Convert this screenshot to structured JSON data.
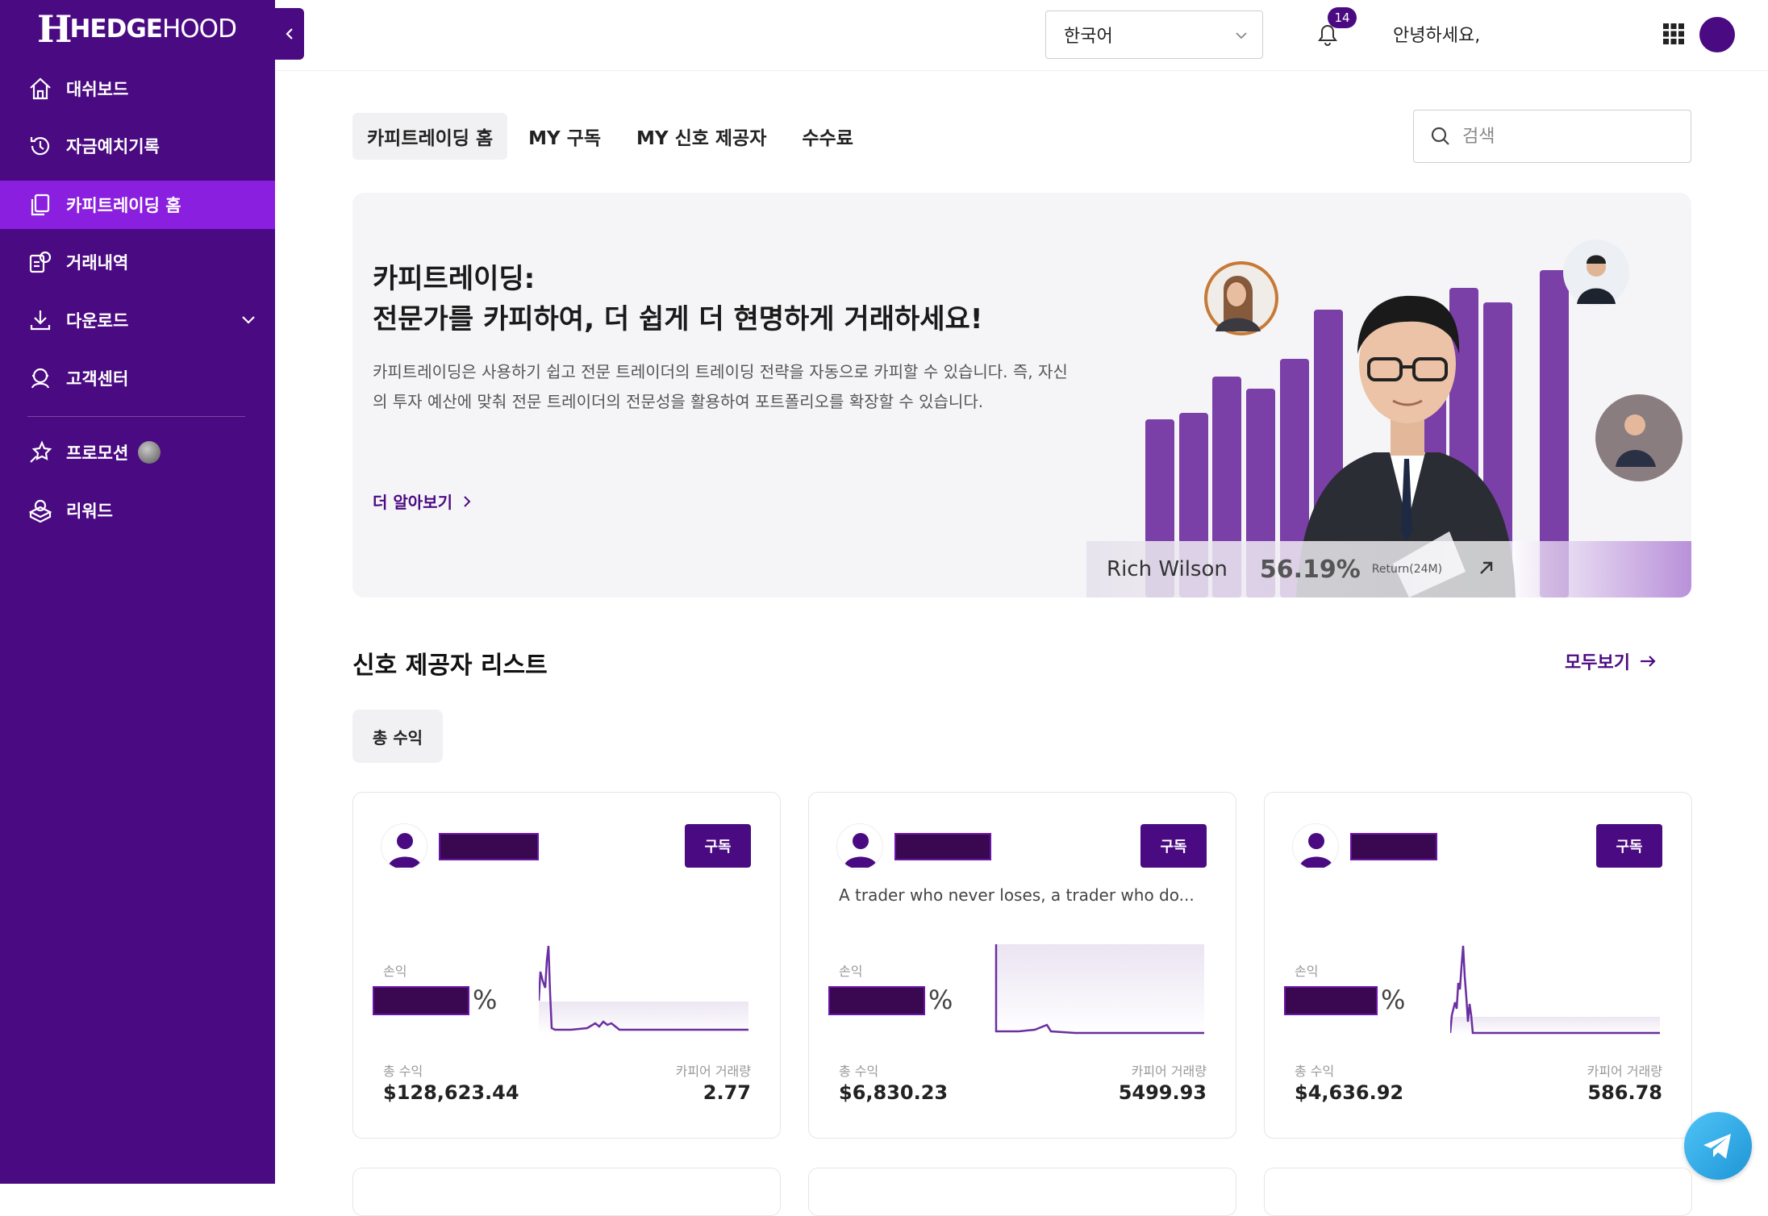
{
  "brand": {
    "name_bold": "HEDGE",
    "name_light": "HOOD"
  },
  "sidebar": {
    "items": [
      {
        "label": "대쉬보드",
        "icon": "home-icon"
      },
      {
        "label": "자금예치기록",
        "icon": "history-icon"
      },
      {
        "label": "카피트레이딩 홈",
        "icon": "copy-icon",
        "active": true
      },
      {
        "label": "거래내역",
        "icon": "transactions-icon"
      },
      {
        "label": "다운로드",
        "icon": "download-icon"
      },
      {
        "label": "고객센터",
        "icon": "support-icon"
      },
      {
        "label": "프로모션",
        "icon": "promotion-icon"
      },
      {
        "label": "리워드",
        "icon": "reward-icon"
      }
    ]
  },
  "topbar": {
    "language": "한국어",
    "notification_count": "14",
    "greeting": "안녕하세요,"
  },
  "tabs": [
    {
      "label": "카피트레이딩 홈",
      "active": true
    },
    {
      "label": "MY 구독"
    },
    {
      "label": "MY 신호 제공자"
    },
    {
      "label": "수수료"
    }
  ],
  "search": {
    "placeholder": "검색"
  },
  "banner": {
    "title_line1": "카피트레이딩:",
    "title_line2": "전문가를 카피하여, 더 쉽게 더 현명하게 거래하세요!",
    "description": "카피트레이딩은 사용하기 쉽고 전문 트레이더의 트레이딩 전략을 자동으로 카피할 수 있습니다. 즉, 자신의 투자 예산에 맞춰 전문 트레이더의 전문성을 활용하여 포트폴리오를 확장할 수 있습니다.",
    "learn_more": "더 알아보기",
    "trader_name": "Rich Wilson",
    "trader_return": "56.19%",
    "return_label": "Return(24M)"
  },
  "providers": {
    "section_title": "신호 제공자 리스트",
    "view_all": "모두보기",
    "filter_chip": "총 수익",
    "cards": [
      {
        "subscribe": "구독",
        "description": "",
        "pl_label": "손익",
        "pl_unit": "%",
        "total_label": "총 수익",
        "total_value": "$128,623.44",
        "volume_label": "카피어 거래량",
        "volume_value": "2.77"
      },
      {
        "subscribe": "구독",
        "description": "A trader who never loses, a trader who do...",
        "pl_label": "손익",
        "pl_unit": "%",
        "total_label": "총 수익",
        "total_value": "$6,830.23",
        "volume_label": "카피어 거래량",
        "volume_value": "5499.93"
      },
      {
        "subscribe": "구독",
        "description": "",
        "pl_label": "손익",
        "pl_unit": "%",
        "total_label": "총 수익",
        "total_value": "$4,636.92",
        "volume_label": "카피어 거래량",
        "volume_value": "586.78"
      }
    ]
  },
  "colors": {
    "brand": "#4a0a82",
    "sidebar_active": "#8a1fe0",
    "spark_line": "#6a2fa0"
  }
}
